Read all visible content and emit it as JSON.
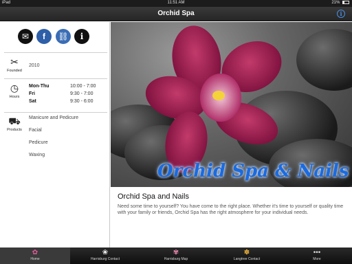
{
  "status_bar": {
    "device": "iPad",
    "time": "11:51 AM",
    "battery": "21%",
    "battery_level": 0.21
  },
  "nav": {
    "title": "Orchid Spa",
    "info_icon": "info-icon"
  },
  "sidebar": {
    "social": [
      {
        "name": "email-icon",
        "glyph": "✉"
      },
      {
        "name": "facebook-icon",
        "glyph": "f"
      },
      {
        "name": "link-icon",
        "glyph": "⛓"
      },
      {
        "name": "info-icon",
        "glyph": "i"
      }
    ],
    "founded": {
      "caption": "Founded",
      "value": "2010"
    },
    "hours": {
      "caption": "Hours",
      "rows": [
        {
          "day": "Mon-Thu",
          "time": "10:00 - 7:00"
        },
        {
          "day": "Fri",
          "time": "9:30 - 7:00"
        },
        {
          "day": "Sat",
          "time": "9:30 - 6:00"
        }
      ]
    },
    "products": {
      "caption": "Products",
      "items": [
        "Manicure and Pedicure",
        "Facial",
        "Pedicure",
        "Waxing"
      ]
    }
  },
  "main": {
    "hero_caption": "Orchid Spa & Nails",
    "article_title": "Orchid Spa and Nails",
    "article_body": "Need some time to yourself? You have come to the right place. Whether  it's time to yourself or  quality time with your family or friends, Orchid Spa has the right atmosphere for your individual needs."
  },
  "tabs": [
    {
      "label": "Home",
      "icon": "orchid-icon"
    },
    {
      "label": "Harrisburg Contact",
      "icon": "white-flower-icon"
    },
    {
      "label": "Harrisburg Map",
      "icon": "pink-flower-icon"
    },
    {
      "label": "Langtree Contact",
      "icon": "yellow-flower-icon"
    },
    {
      "label": "More",
      "icon": "more-icon"
    }
  ],
  "colors": {
    "accent": "#1a6be0",
    "nav_bg": "#2e2e2e",
    "tab_bg": "#1a1a1a"
  }
}
